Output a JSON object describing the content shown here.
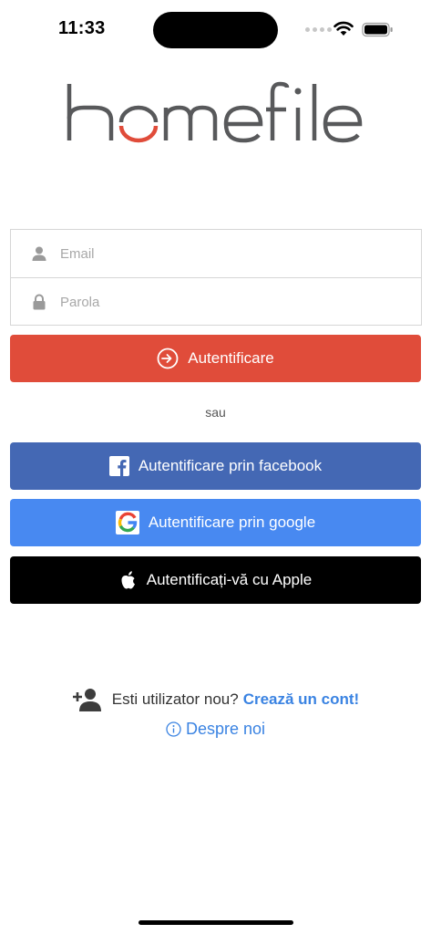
{
  "status_bar": {
    "time": "11:33"
  },
  "logo": {
    "text": "homefile",
    "brand_color": "#e04c3a",
    "text_color": "#58595b"
  },
  "form": {
    "email_placeholder": "Email",
    "password_placeholder": "Parola",
    "email_icon": "user-icon",
    "password_icon": "lock-icon"
  },
  "buttons": {
    "login": {
      "label": "Autentificare",
      "icon": "sign-in-icon",
      "color": "#e04c3a"
    },
    "facebook": {
      "label": "Autentificare prin facebook",
      "icon": "facebook-icon",
      "color": "#4468b4"
    },
    "google": {
      "label": "Autentificare prin google",
      "icon": "google-icon",
      "color": "#4889f1"
    },
    "apple": {
      "label": "Autentificați-vă cu Apple",
      "icon": "apple-icon",
      "color": "#000000"
    }
  },
  "separator": {
    "text": "sau"
  },
  "signup": {
    "prompt": "Esti utilizator nou?",
    "link": "Crează un cont!",
    "icon": "add-user-icon"
  },
  "about": {
    "label": "Despre noi",
    "icon": "info-icon",
    "color": "#3a83e2"
  }
}
